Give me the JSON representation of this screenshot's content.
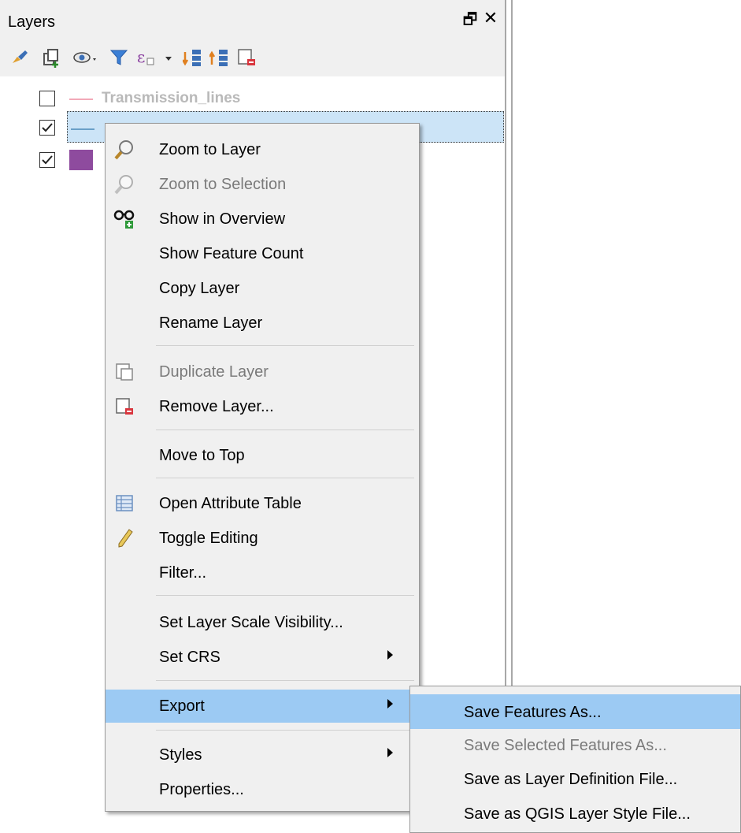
{
  "panel": {
    "title": "Layers",
    "float_glyph": "🗗",
    "close_glyph": "✕",
    "toolbar_icons": [
      "style-brush-icon",
      "add-group-icon",
      "visibility-eye-icon",
      "filter-funnel-icon",
      "expression-filter-icon",
      "expand-all-icon",
      "collapse-all-icon",
      "remove-layer-icon"
    ]
  },
  "layers": [
    {
      "name": "Transmission_lines",
      "checked": false,
      "symbol": "line",
      "color": "#f2a9b8"
    },
    {
      "name": "",
      "checked": true,
      "symbol": "line",
      "color": "#6aa0c8",
      "selected": true
    },
    {
      "name": "",
      "checked": true,
      "symbol": "fill",
      "color": "#8e4b9e"
    }
  ],
  "context_menu": {
    "items": [
      {
        "label": "Zoom to Layer",
        "icon": "zoom-layer-icon",
        "disabled": false
      },
      {
        "label": "Zoom to Selection",
        "icon": "zoom-selection-icon",
        "disabled": true
      },
      {
        "label": "Show in Overview",
        "icon": "overview-glasses-icon",
        "disabled": false
      },
      {
        "label": "Show Feature Count",
        "disabled": false
      },
      {
        "label": "Copy Layer",
        "disabled": false
      },
      {
        "label": "Rename Layer",
        "disabled": false
      },
      {
        "label": "Duplicate Layer",
        "icon": "duplicate-layer-icon",
        "disabled": true
      },
      {
        "label": "Remove Layer...",
        "icon": "remove-layer-icon",
        "disabled": false
      },
      {
        "label": "Move to Top",
        "disabled": false
      },
      {
        "label": "Open Attribute Table",
        "icon": "attribute-table-icon",
        "disabled": false
      },
      {
        "label": "Toggle Editing",
        "icon": "pencil-icon",
        "disabled": false
      },
      {
        "label": "Filter...",
        "disabled": false
      },
      {
        "label": "Set Layer Scale Visibility...",
        "disabled": false
      },
      {
        "label": "Set CRS",
        "disabled": false,
        "submenu": true
      },
      {
        "label": "Export",
        "disabled": false,
        "submenu": true,
        "highlighted": true
      },
      {
        "label": "Styles",
        "disabled": false,
        "submenu": true
      },
      {
        "label": "Properties...",
        "disabled": false
      }
    ]
  },
  "export_submenu": {
    "items": [
      {
        "label": "Save Features As...",
        "disabled": false,
        "highlighted": true
      },
      {
        "label": "Save Selected Features As...",
        "disabled": true
      },
      {
        "label": "Save as Layer Definition File...",
        "disabled": false
      },
      {
        "label": "Save as QGIS Layer Style File...",
        "disabled": false
      }
    ]
  },
  "colors": {
    "highlight": "#9ccaf3",
    "selection": "#cce4f7",
    "menu_bg": "#f0f0f0",
    "disabled_text": "#7a7a7a"
  }
}
